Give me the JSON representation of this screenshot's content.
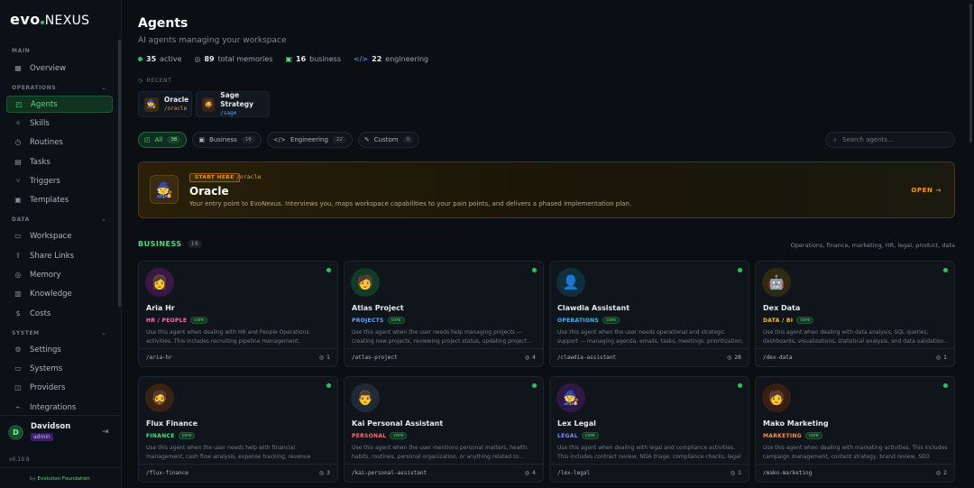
{
  "brand": {
    "evo": "evo",
    "nexus": "NEXUS"
  },
  "sidebar": {
    "sections": [
      {
        "label": "MAIN"
      },
      {
        "label": "OPERATIONS"
      },
      {
        "label": "DATA"
      },
      {
        "label": "SYSTEM"
      }
    ],
    "items": [
      {
        "label": "Overview",
        "icon": "grid-icon"
      },
      {
        "label": "Agents",
        "icon": "bot-icon"
      },
      {
        "label": "Skills",
        "icon": "sparkle-icon"
      },
      {
        "label": "Routines",
        "icon": "clock-icon"
      },
      {
        "label": "Tasks",
        "icon": "calendar-icon"
      },
      {
        "label": "Triggers",
        "icon": "flow-icon"
      },
      {
        "label": "Templates",
        "icon": "layout-icon"
      },
      {
        "label": "Workspace",
        "icon": "folder-icon"
      },
      {
        "label": "Share Links",
        "icon": "share-icon"
      },
      {
        "label": "Memory",
        "icon": "database-icon"
      },
      {
        "label": "Knowledge",
        "icon": "book-icon"
      },
      {
        "label": "Costs",
        "icon": "dollar-icon"
      },
      {
        "label": "Settings",
        "icon": "gear-icon"
      },
      {
        "label": "Systems",
        "icon": "monitor-icon"
      },
      {
        "label": "Providers",
        "icon": "chip-icon"
      },
      {
        "label": "Integrations",
        "icon": "plug-icon"
      }
    ],
    "user": {
      "initial": "D",
      "name": "Davidson",
      "role": "admin"
    },
    "version": "v0.19.8",
    "footer_by": "by",
    "footer_org": "Evolution Foundation"
  },
  "header": {
    "title": "Agents",
    "subtitle": "AI agents managing your workspace",
    "stats": [
      {
        "value": "35",
        "label": "active"
      },
      {
        "value": "89",
        "label": "total memories"
      },
      {
        "value": "16",
        "label": "business"
      },
      {
        "value": "22",
        "label": "engineering"
      }
    ]
  },
  "recent": {
    "label": "RECENT",
    "items": [
      {
        "name": "Oracle",
        "slug": "/oracle",
        "slug_color": "#d4a537"
      },
      {
        "name": "Sage Strategy",
        "slug": "/sage",
        "slug_color": "#60a5fa"
      }
    ]
  },
  "filters": [
    {
      "label": "All",
      "count": "38"
    },
    {
      "label": "Business",
      "count": "16"
    },
    {
      "label": "Engineering",
      "count": "22"
    },
    {
      "label": "Custom",
      "count": "0"
    }
  ],
  "search": {
    "placeholder": "Search agents..."
  },
  "hero": {
    "badge": "START HERE",
    "slug": "/oracle",
    "title": "Oracle",
    "description": "Your entry point to EvoNexus. Interviews you, maps workspace capabilities to your pain points, and delivers a phased implementation plan.",
    "cta": "OPEN →"
  },
  "business": {
    "title": "BUSINESS",
    "count": "16",
    "description": "Operations, finance, marketing, HR, legal, product, data",
    "cards": [
      {
        "name": "Aria Hr",
        "tag": "HR / PEOPLE",
        "tag_color": "#f472b6",
        "core": "core",
        "desc": "Use this agent when dealing with HR and People Operations activities. This includes recruiting pipeline management, performan...",
        "slug": "/aria-hr",
        "memories": "1",
        "av_bg": "#3b1746",
        "av_glyph": "👩"
      },
      {
        "name": "Atlas Project",
        "tag": "PROJECTS",
        "tag_color": "#60a5fa",
        "core": "core",
        "desc": "Use this agent when the user needs help managing projects — creating new projects, reviewing project status, updating project...",
        "slug": "/atlas-project",
        "memories": "4",
        "av_bg": "#123a24",
        "av_glyph": "🧑"
      },
      {
        "name": "Clawdia Assistant",
        "tag": "OPERATIONS",
        "tag_color": "#38bdf8",
        "core": "core",
        "desc": "Use this agent when the user needs operational and strategic support — managing agenda, emails, tasks, meetings, prioritization, decisio...",
        "slug": "/clawdia-assistant",
        "memories": "28",
        "av_bg": "#0f2f3d",
        "av_glyph": "👤"
      },
      {
        "name": "Dex Data",
        "tag": "DATA / BI",
        "tag_color": "#fbbf24",
        "core": "core",
        "desc": "Use this agent when dealing with data analysis, SQL queries, dashboards, visualizations, statistical analysis, and data validation...",
        "slug": "/dex-data",
        "memories": "1",
        "av_bg": "#2f2a12",
        "av_glyph": "🤖"
      },
      {
        "name": "Flux Finance",
        "tag": "FINANCE",
        "tag_color": "#4ade80",
        "core": "core",
        "desc": "Use this agent when the user needs help with financial management, cash flow analysis, expense tracking, revenue monitoring, financial...",
        "slug": "/flux-finance",
        "memories": "3",
        "av_bg": "#3a2212",
        "av_glyph": "🧔"
      },
      {
        "name": "Kai Personal Assistant",
        "tag": "PERSONAL",
        "tag_color": "#f87171",
        "core": "core",
        "desc": "Use this agent when the user mentions personal matters, health, habits, routines, personal organization, or anything related to...",
        "slug": "/kai-personal-assistant",
        "memories": "4",
        "av_bg": "#1f2a36",
        "av_glyph": "👨"
      },
      {
        "name": "Lex Legal",
        "tag": "LEGAL",
        "tag_color": "#818cf8",
        "core": "core",
        "desc": "Use this agent when dealing with legal and compliance activities. This includes contract review, NDA triage, compliance checks, legal risk...",
        "slug": "/lex-legal",
        "memories": "1",
        "av_bg": "#2d1846",
        "av_glyph": "🧙"
      },
      {
        "name": "Mako Marketing",
        "tag": "MARKETING",
        "tag_color": "#fb923c",
        "core": "core",
        "desc": "Use this agent when dealing with marketing activities. This includes campaign management, content strategy, brand review, SEO audits...",
        "slug": "/mako-marketing",
        "memories": "2",
        "av_bg": "#3a1e12",
        "av_glyph": "🧑"
      }
    ]
  }
}
